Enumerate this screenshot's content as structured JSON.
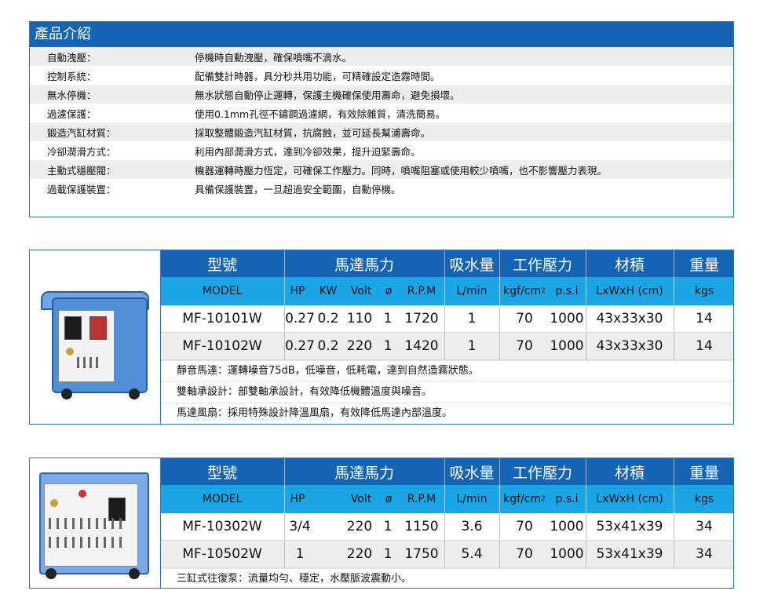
{
  "intro": {
    "title": "產品介紹",
    "rows": [
      {
        "label": "自動洩壓：",
        "value": "停機時自動洩壓，確保噴嘴不滴水。"
      },
      {
        "label": "控制系統：",
        "value": "配備雙計時器，具分秒共用功能，可精確設定造霧時間。"
      },
      {
        "label": "無水停機：",
        "value": "無水狀態自動停止運轉，保護主機確保使用壽命，避免損壞。"
      },
      {
        "label": "過濾保護：",
        "value": "使用0.1mm孔徑不鏽鋼過濾網，有效除雜質，清洗簡易。"
      },
      {
        "label": "鍛造汽缸材質：",
        "value": "採取整體鍛造汽缸材質，抗腐蝕，並可延長幫浦壽命。"
      },
      {
        "label": "冷卻潤滑方式：",
        "value": "利用內部潤滑方式，達到冷卻效果，提升迫緊壽命。"
      },
      {
        "label": "主動式穩壓閥：",
        "value": "機器運轉時壓力恆定，可確保工作壓力。同時，噴嘴阻塞或使用較少噴嘴，也不影響壓力表現。"
      },
      {
        "label": "過載保護裝置：",
        "value": "具備保護裝置，一旦超過安全範圍，自動停機。"
      }
    ]
  },
  "headers": {
    "model": "型號",
    "motor": "馬達馬力",
    "suction": "吸水量",
    "pressure": "工作壓力",
    "volume": "材積",
    "weight": "重量"
  },
  "subheaders": {
    "model": "MODEL",
    "hp": "HP",
    "kw": "KW",
    "volt": "Volt",
    "phase": "ø",
    "rpm": "R.P.M",
    "lmin": "L/min",
    "kgf": "kgf/cm",
    "kgf_sup": "2",
    "psi": "p.s.i",
    "dim": "LxWxH (cm)",
    "kgs": "kgs"
  },
  "product1": {
    "rows": [
      {
        "model": "MF-10101W",
        "hp": "0.27",
        "kw": "0.2",
        "volt": "110",
        "phase": "1",
        "rpm": "1720",
        "lmin": "1",
        "kgf": "70",
        "psi": "1000",
        "dim": "43x33x30",
        "kgs": "14"
      },
      {
        "model": "MF-10102W",
        "hp": "0.27",
        "kw": "0.2",
        "volt": "220",
        "phase": "1",
        "rpm": "1420",
        "lmin": "1",
        "kgf": "70",
        "psi": "1000",
        "dim": "43x33x30",
        "kgs": "14"
      }
    ],
    "notes": [
      "靜音馬達：運轉噪音75dB，低噪音，低耗電，達到自然造霧狀態。",
      "雙軸承設計：部雙軸承設計，有效降低機體溫度與噪音。",
      "馬達風扇：採用特殊設計降溫風扇，有效降低馬達內部溫度。"
    ]
  },
  "product2": {
    "rows": [
      {
        "model": "MF-10302W",
        "hp": "3/4",
        "volt": "220",
        "phase": "1",
        "rpm": "1150",
        "lmin": "3.6",
        "kgf": "70",
        "psi": "1000",
        "dim": "53x41x39",
        "kgs": "34"
      },
      {
        "model": "MF-10502W",
        "hp": "1",
        "volt": "220",
        "phase": "1",
        "rpm": "1750",
        "lmin": "5.4",
        "kgf": "70",
        "psi": "1000",
        "dim": "53x41x39",
        "kgs": "34"
      }
    ],
    "notes": [
      "三缸式往復泵：流量均勻、穩定，水壓脈波震動小。"
    ]
  },
  "colors": {
    "header_blue": "#1565b4",
    "subheader_blue": "#1aa6e6",
    "row_alt": "#eeeeee"
  }
}
